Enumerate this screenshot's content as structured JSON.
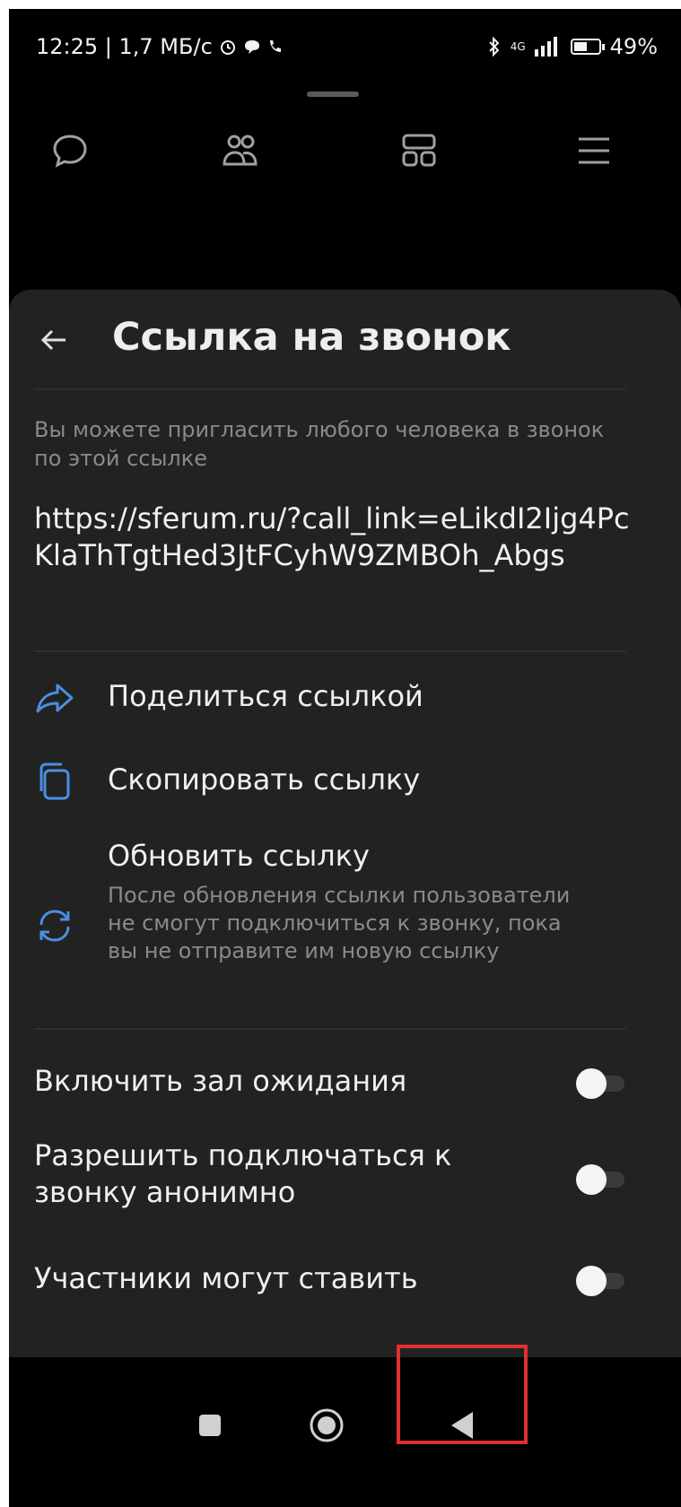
{
  "status_bar": {
    "time_speed": "12:25 | 1,7 МБ/с",
    "network": "4G",
    "battery": "49%"
  },
  "tabs": [
    {
      "icon": "chat-icon"
    },
    {
      "icon": "contacts-icon"
    },
    {
      "icon": "services-icon"
    },
    {
      "icon": "menu-icon"
    }
  ],
  "sheet": {
    "title": "Ссылка на звонок",
    "description": "Вы можете пригласить любого человека в звонок по этой ссылке",
    "link": "https://sferum.ru/?call_link=eLikdI2Ijg4PcKlaThTgtHed3JtFCyhW9ZMBOh_Abgs",
    "actions": {
      "share": "Поделиться ссылкой",
      "copy": "Скопировать ссылку",
      "refresh": "Обновить ссылку",
      "refresh_note": "После обновления ссылки пользователи не смогут подключиться к звонку, пока вы не отправите им новую ссылку"
    },
    "toggles": {
      "waiting_room": "Включить зал ожидания",
      "anonymous": "Разрешить подключаться к звонку анонимно",
      "participants": "Участники могут ставить"
    }
  },
  "colors": {
    "accent": "#4a8fe0",
    "sheet_bg": "#222222",
    "highlight": "#e03030"
  }
}
